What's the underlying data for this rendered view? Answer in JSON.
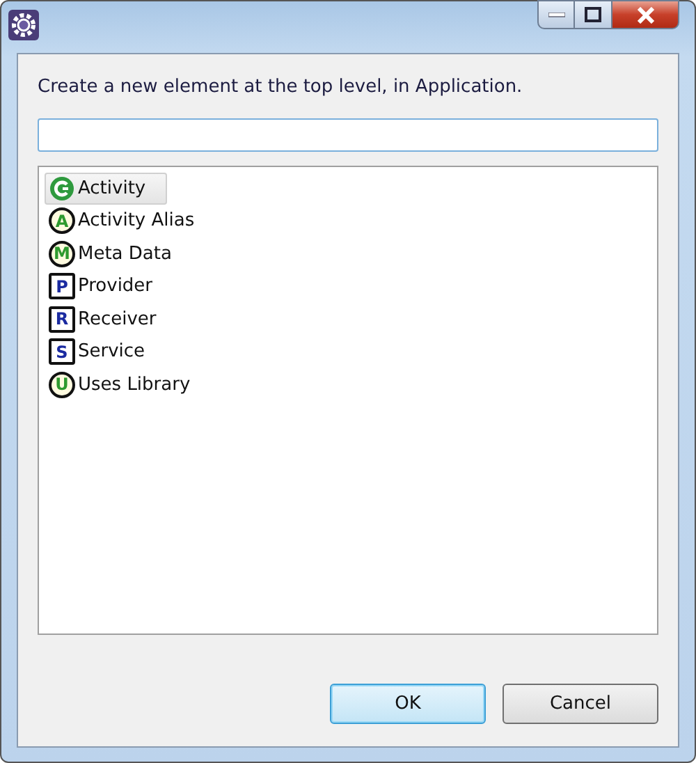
{
  "prompt": "Create a new element at the top level, in Application.",
  "items": [
    {
      "label": "Activity",
      "kind": "activity",
      "selected": true
    },
    {
      "label": "Activity Alias",
      "kind": "circle",
      "icon_letter": "A",
      "selected": false
    },
    {
      "label": "Meta Data",
      "kind": "circle",
      "icon_letter": "M",
      "selected": false
    },
    {
      "label": "Provider",
      "kind": "square",
      "icon_letter": "P",
      "selected": false
    },
    {
      "label": "Receiver",
      "kind": "square",
      "icon_letter": "R",
      "selected": false
    },
    {
      "label": "Service",
      "kind": "square",
      "icon_letter": "S",
      "selected": false
    },
    {
      "label": "Uses Library",
      "kind": "circle",
      "icon_letter": "U",
      "selected": false
    }
  ],
  "buttons": [
    {
      "label": "OK",
      "default": true
    },
    {
      "label": "Cancel",
      "default": false
    }
  ]
}
